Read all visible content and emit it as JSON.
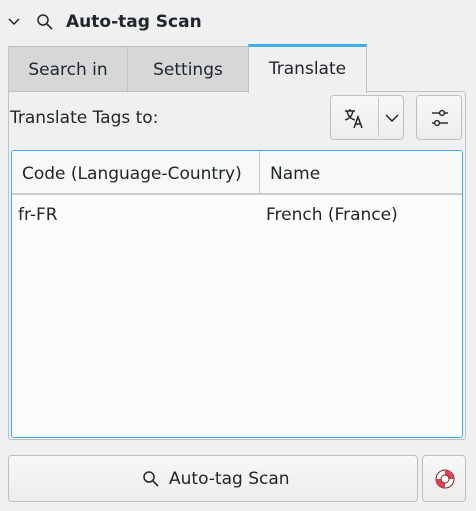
{
  "header": {
    "title": "Auto-tag Scan",
    "icons": [
      "chevron-down-icon",
      "search-icon"
    ]
  },
  "tabs": [
    {
      "label": "Search in",
      "active": false
    },
    {
      "label": "Settings",
      "active": false
    },
    {
      "label": "Translate",
      "active": true
    }
  ],
  "translate": {
    "label": "Translate Tags to:",
    "language_button_icon": "translate-icon",
    "config_button_icon": "sliders-icon"
  },
  "table": {
    "columns": [
      "Code (Language-Country)",
      "Name"
    ],
    "rows": [
      {
        "code": "fr-FR",
        "name": "French (France)"
      }
    ]
  },
  "footer": {
    "scan_label": "Auto-tag Scan",
    "help_icon": "lifebuoy-icon"
  },
  "colors": {
    "accent": "#3daee9",
    "background": "#eff0f1",
    "help_icon_red": "#da4453"
  }
}
